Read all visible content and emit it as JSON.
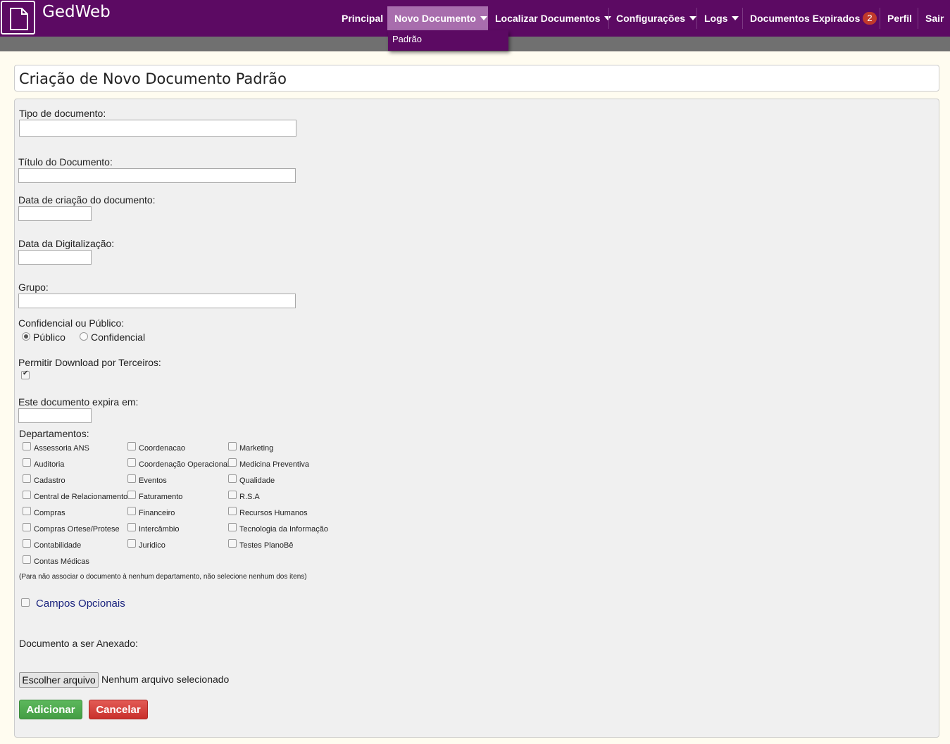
{
  "app": {
    "brand": "GedWeb",
    "logo_icon": "document-icon"
  },
  "nav": {
    "items": [
      {
        "label": "Principal"
      },
      {
        "label": "Novo Documento",
        "active": true
      },
      {
        "label": "Localizar Documentos"
      },
      {
        "label": "Configurações"
      },
      {
        "label": "Logs"
      },
      {
        "label": "Documentos Expirados",
        "badge": "2"
      },
      {
        "label": "Perfil"
      },
      {
        "label": "Sair"
      }
    ],
    "dropdown": {
      "items": [
        {
          "label": "Padrão"
        }
      ]
    }
  },
  "page": {
    "title": "Criação de Novo Documento Padrão"
  },
  "form": {
    "tipo_label": "Tipo de documento:",
    "titulo_label": "Título do Documento:",
    "data_criacao_label": "Data de criação do documento:",
    "data_digitalizacao_label": "Data da Digitalização:",
    "grupo_label": "Grupo:",
    "confidencial_label": "Confidencial ou Público:",
    "radio_publico": "Público",
    "radio_confidencial": "Confidencial",
    "radio_selected": "Público",
    "download_label": "Permitir Download por Terceiros:",
    "download_checked": true,
    "expira_label": "Este documento expira em:",
    "departamentos_label": "Departamentos:",
    "departamentos": {
      "col1": [
        "Assessoria ANS",
        "Auditoria",
        "Cadastro",
        "Central de Relacionamento",
        "Compras",
        "Compras Ortese/Protese",
        "Contabilidade",
        "Contas Médicas"
      ],
      "col2": [
        "Coordenacao",
        "Coordenação Operacional",
        "Eventos",
        "Faturamento",
        "Financeiro",
        "Intercâmbio",
        "Juridico"
      ],
      "col3": [
        "Marketing",
        "Medicina Preventiva",
        "Qualidade",
        "R.S.A",
        "Recursos Humanos",
        "Tecnologia da Informação",
        "Testes PlanoBê"
      ]
    },
    "departamentos_note": "(Para não associar o documento à nenhum departamento, não selecione nenhum dos itens)",
    "campos_opcionais": "Campos Opcionais",
    "anexo_label": "Documento a ser Anexado:",
    "file_button": "Escolher arquivo",
    "file_status": "Nenhum arquivo selecionado",
    "btn_adicionar": "Adicionar",
    "btn_cancelar": "Cancelar"
  },
  "colors": {
    "topbar": "#5c0a63",
    "active_nav": "#a86dad",
    "badge": "#c0392b",
    "add": "#5cb85c",
    "cancel": "#d9534f"
  }
}
